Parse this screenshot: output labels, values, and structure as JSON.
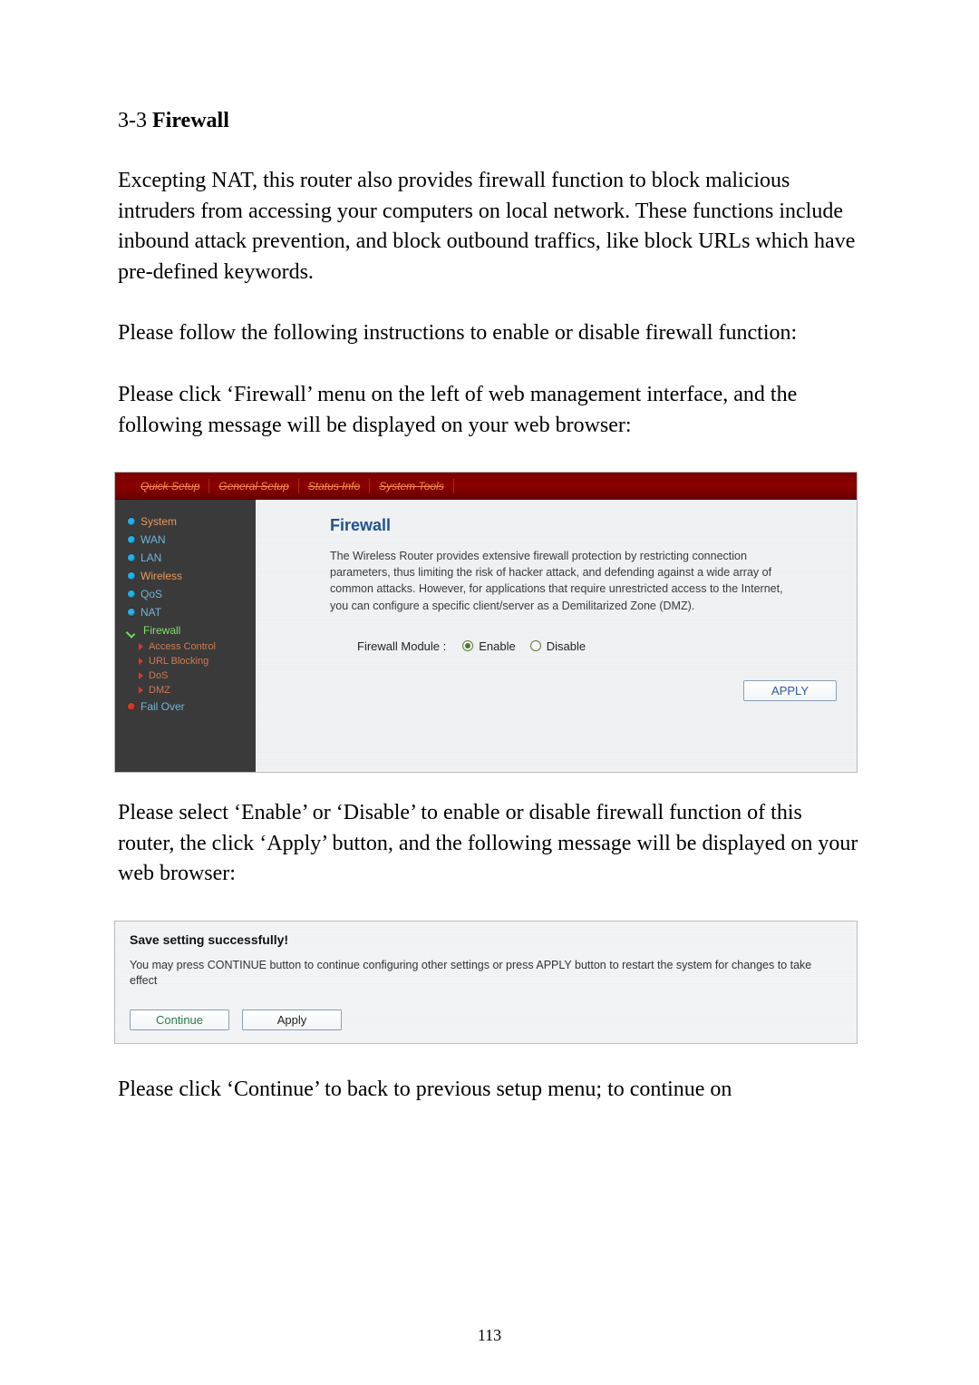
{
  "section": {
    "num": "3-3",
    "title": "Firewall"
  },
  "paragraphs": {
    "p1": "Excepting NAT, this router also provides firewall function to block malicious intruders from accessing your computers on local network. These functions include inbound attack prevention, and block outbound traffics, like block URLs which have pre-defined keywords.",
    "p2": "Please follow the following instructions to enable or disable firewall function:",
    "p3": "Please click ‘Firewall’ menu on the left of web management interface, and the following message will be displayed on your web browser:",
    "p4": "Please select ‘Enable’ or ‘Disable’ to enable or disable firewall function of this router, the click ‘Apply’ button, and the following message will be displayed on your web browser:",
    "p5": "Please click ‘Continue’ to back to previous setup menu; to continue on"
  },
  "shot1": {
    "tabs": [
      "Quick Setup",
      "General Setup",
      "Status Info",
      "System Tools"
    ],
    "sidebar": {
      "system": "System",
      "wan": "WAN",
      "lan": "LAN",
      "wireless": "Wireless",
      "qos": "QoS",
      "nat": "NAT",
      "firewall": "Firewall",
      "access_control": "Access Control",
      "url_blocking": "URL Blocking",
      "dos": "DoS",
      "dmz": "DMZ",
      "fail_over": "Fail Over"
    },
    "panel": {
      "title": "Firewall",
      "desc": "The Wireless Router provides extensive firewall protection by restricting connection parameters, thus limiting the risk of hacker attack, and defending against a wide array of common attacks. However, for applications that require unrestricted access to the Internet, you can configure a specific client/server as a Demilitarized Zone (DMZ).",
      "module_label": "Firewall Module :",
      "enable": "Enable",
      "disable": "Disable",
      "apply": "APPLY"
    }
  },
  "shot2": {
    "title": "Save setting successfully!",
    "desc": "You may press CONTINUE button to continue configuring other settings or press APPLY button to restart the system for changes to take effect",
    "continue": "Continue",
    "apply": "Apply"
  },
  "page_number": "113"
}
